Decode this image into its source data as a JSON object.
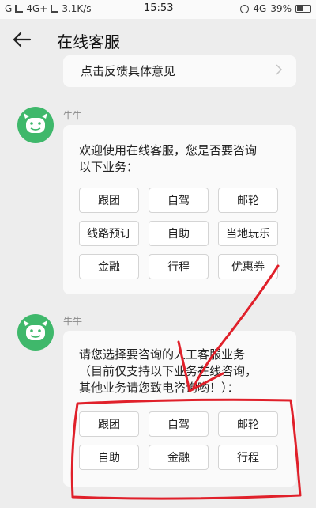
{
  "status_bar": {
    "carrier": "G",
    "network": "4G+",
    "speed": "3.1K/s",
    "time": "15:53",
    "network_right": "4G",
    "battery": "39%"
  },
  "nav": {
    "title": "在线客服",
    "back_icon": "arrow-left-icon"
  },
  "feedback": {
    "label": "点击反馈具体意见"
  },
  "messages": [
    {
      "sender": "牛牛",
      "text": "欢迎使用在线客服，您是否要咨询\n以下业务：",
      "options": [
        "跟团",
        "自驾",
        "邮轮",
        "线路预订",
        "自助",
        "当地玩乐",
        "金融",
        "行程",
        "优惠券"
      ]
    },
    {
      "sender": "牛牛",
      "text": "请您选择要咨询的人工客服业务\n（目前仅支持以下业务在线咨询，\n其他业务请您致电咨询哟！）：",
      "options": [
        "跟团",
        "自驾",
        "邮轮",
        "自助",
        "金融",
        "行程"
      ]
    }
  ],
  "colors": {
    "avatar_green": "#3fb86b",
    "annotation_red": "#e0202a",
    "background": "#ededed"
  }
}
